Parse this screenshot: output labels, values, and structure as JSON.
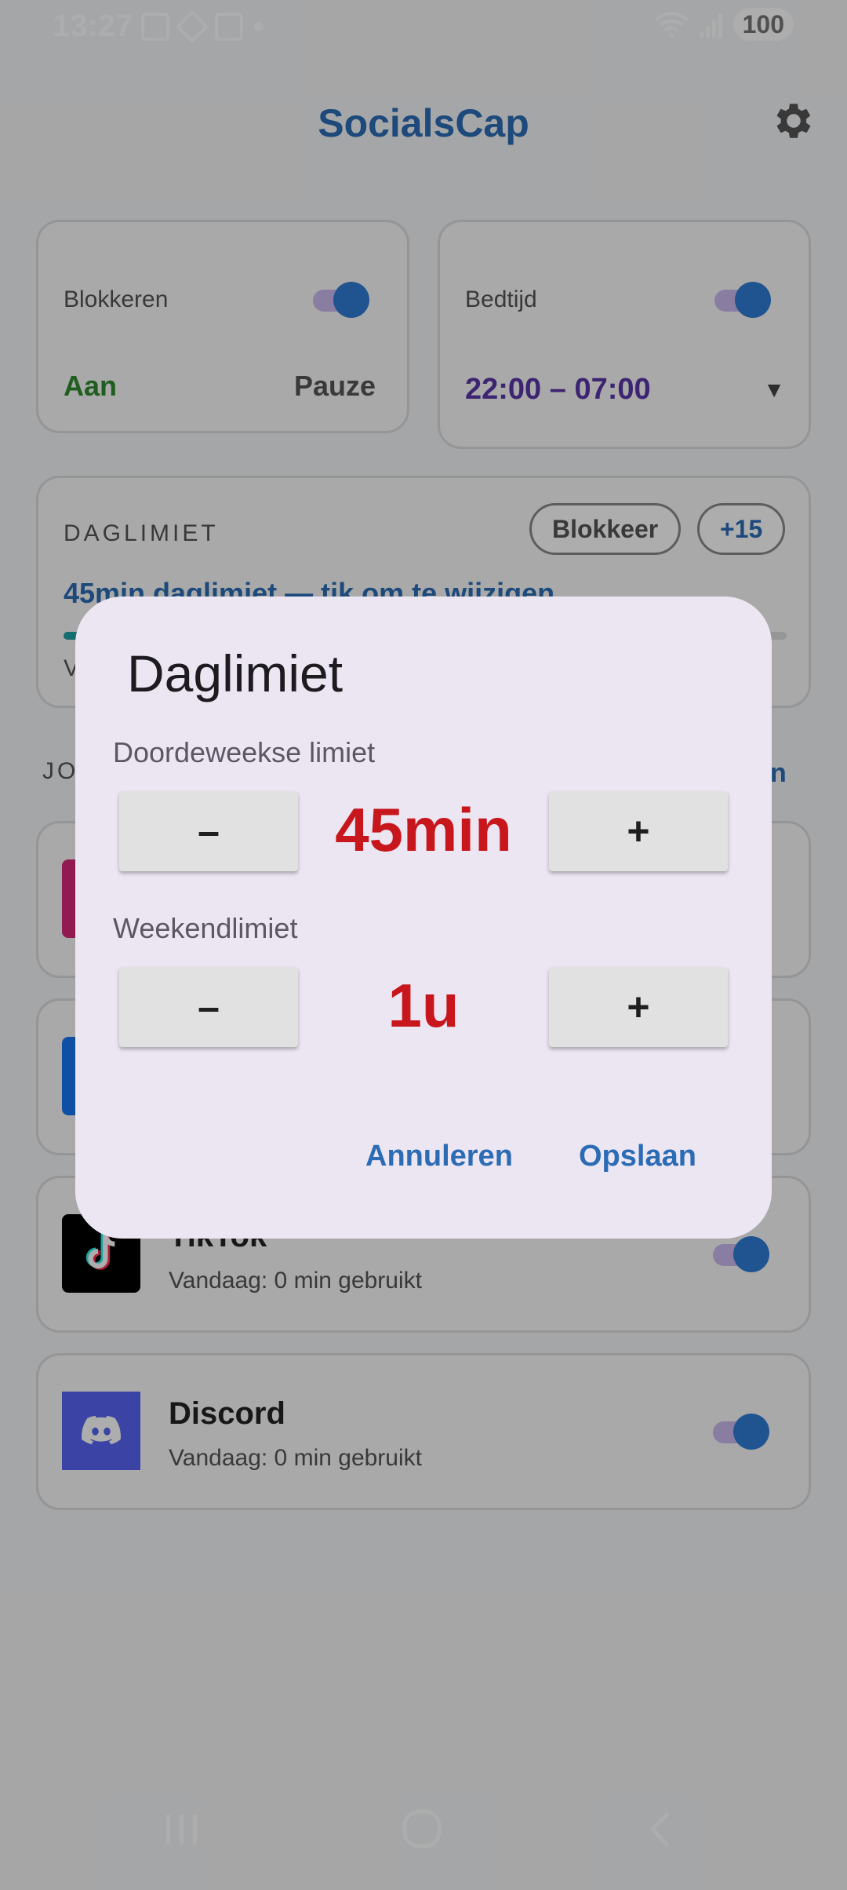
{
  "status_bar": {
    "time": "13:27",
    "battery": "100"
  },
  "header": {
    "title": "SocialsCap",
    "settings_icon": "gear-icon"
  },
  "blokkeren": {
    "label": "Blokkeren",
    "state": "Aan",
    "state_color": "#2e8b2e",
    "pause_label": "Pauze"
  },
  "bedtijd": {
    "label": "Bedtijd",
    "range": "22:00 – 07:00",
    "range_color": "#5a35a8",
    "dropdown_glyph": "▼"
  },
  "daglimiet_card": {
    "heading": "DAGLIMIET",
    "block_button": "Blokkeer",
    "plus_button": "+15",
    "summary": "45min daglimiet — tik om te wijzigen",
    "progress": 0.05,
    "partial_row_start": "V"
  },
  "section": {
    "heading_partial": "JO",
    "right_link_partial": "n"
  },
  "apps": [
    {
      "name": "",
      "usage": "",
      "icon": "instagram-icon",
      "icon_color": "#d62976"
    },
    {
      "name": "",
      "usage": "",
      "icon": "facebook-icon",
      "icon_color": "#1877f2"
    },
    {
      "name": "TikTok",
      "usage": "Vandaag: 0 min gebruikt",
      "icon": "tiktok-icon",
      "icon_color": "#000000"
    },
    {
      "name": "Discord",
      "usage": "Vandaag: 0 min gebruikt",
      "icon": "discord-icon",
      "icon_color": "#5865f2"
    }
  ],
  "dialog": {
    "title": "Daglimiet",
    "weekday_label": "Doordeweekse limiet",
    "weekday_value": "45min",
    "weekend_label": "Weekendlimiet",
    "weekend_value": "1u",
    "minus_glyph": "–",
    "plus_glyph": "+",
    "cancel": "Annuleren",
    "save": "Opslaan"
  },
  "colors": {
    "accent": "#2b6cb5",
    "limit_value": "#c8161d"
  }
}
